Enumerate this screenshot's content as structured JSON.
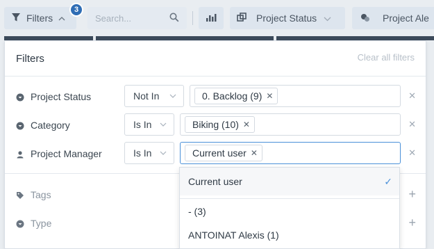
{
  "toolbar": {
    "filters_label": "Filters",
    "filters_count": "3",
    "search_placeholder": "Search...",
    "project_status_label": "Project Status",
    "manager_label": "Project Ale"
  },
  "panel": {
    "title": "Filters",
    "clear_all": "Clear all filters",
    "rows": [
      {
        "label": "Project Status",
        "operator": "Not In",
        "value": "0. Backlog (9)"
      },
      {
        "label": "Category",
        "operator": "Is In",
        "value": "Biking (10)"
      },
      {
        "label": "Project Manager",
        "operator": "Is In",
        "value": "Current user"
      }
    ],
    "extra_rows": [
      {
        "label": "Tags"
      },
      {
        "label": "Type"
      }
    ]
  },
  "dropdown": {
    "options": [
      "Current user",
      "- (3)",
      "ANTOINAT Alexis (1)"
    ]
  },
  "colors": {
    "accent": "#2f6db5",
    "focus": "#4a90d9",
    "topbar_bg": "#e9edf1",
    "button_bg": "#dde5ee"
  }
}
